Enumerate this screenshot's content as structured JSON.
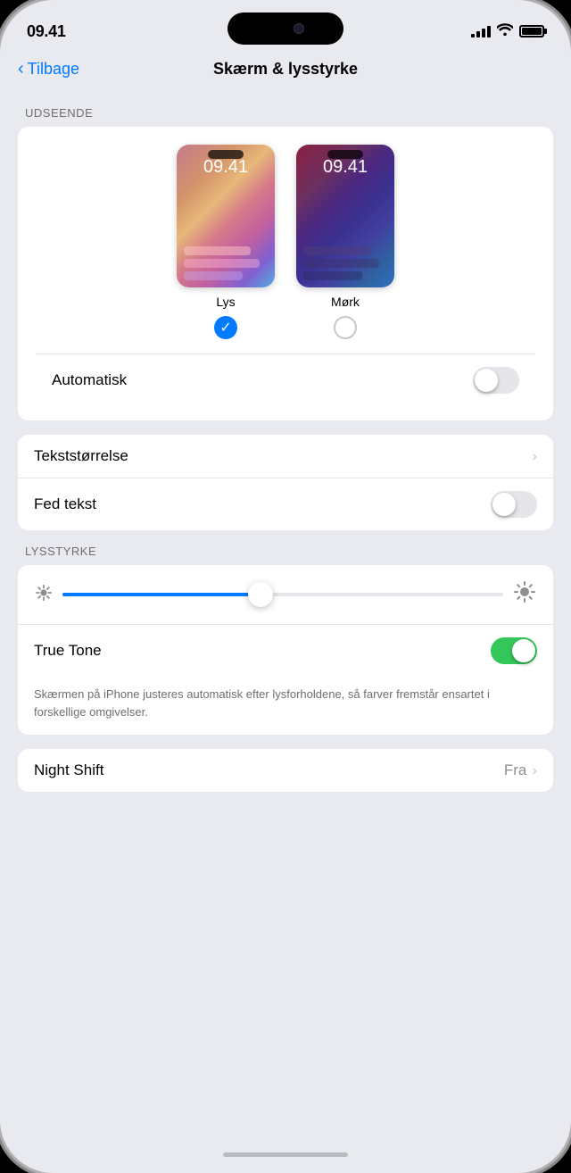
{
  "status": {
    "time": "09.41",
    "signal_bars": [
      4,
      7,
      10,
      13
    ],
    "battery_level": "100"
  },
  "nav": {
    "back_label": "Tilbage",
    "title": "Skærm & lysstyrke"
  },
  "sections": {
    "appearance": {
      "label": "UDSEENDE",
      "options": [
        {
          "id": "light",
          "label": "Lys",
          "selected": true,
          "time": "09.41"
        },
        {
          "id": "dark",
          "label": "Mørk",
          "selected": false,
          "time": "09.41"
        }
      ],
      "auto_label": "Automatisk",
      "auto_on": false
    },
    "text": {
      "text_size_label": "Tekststørrelse",
      "bold_text_label": "Fed tekst",
      "bold_on": false
    },
    "brightness": {
      "label": "LYSSTYRKE",
      "slider_percent": 45,
      "true_tone_label": "True Tone",
      "true_tone_on": true,
      "true_tone_desc": "Skærmen på iPhone justeres automatisk efter lysforholdene, så farver fremstår ensartet i forskellige omgivelser."
    },
    "night_shift": {
      "label": "Night Shift",
      "value": "Fra",
      "has_chevron": true
    }
  }
}
